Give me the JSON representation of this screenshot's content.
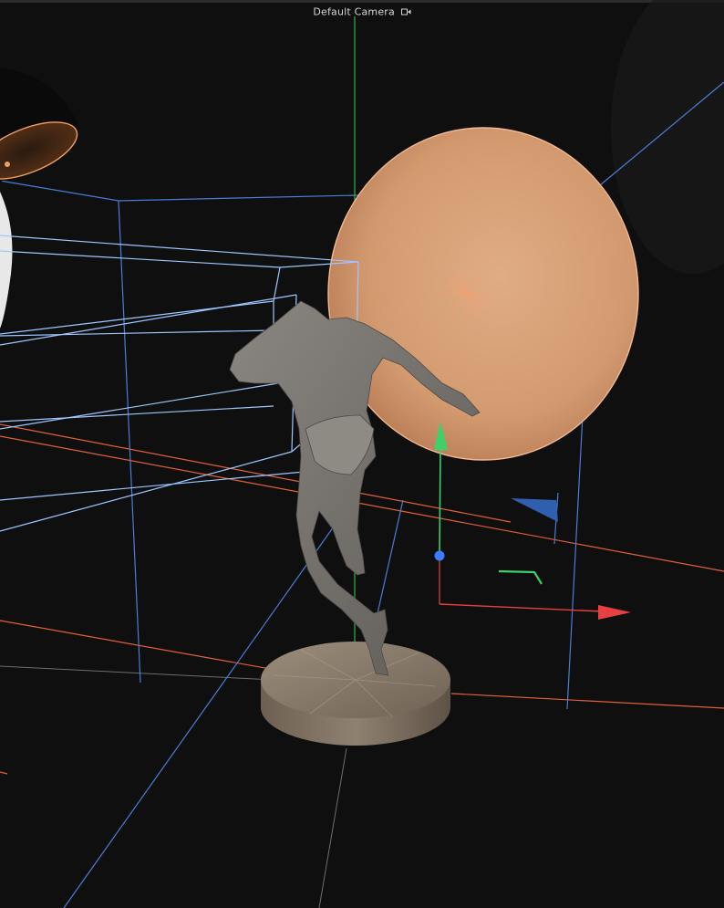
{
  "viewport": {
    "camera_label": "Default Camera",
    "camera_icon": "camera-icon"
  },
  "scene": {
    "objects": [
      {
        "name": "area-light-disc",
        "color": "#f0a060"
      },
      {
        "name": "sphere-light",
        "color": "#d9a07a"
      },
      {
        "name": "figure-sculpture",
        "color": "#7a7672"
      },
      {
        "name": "pedestal-base",
        "color": "#8c7d6c"
      }
    ],
    "gizmo": {
      "x_axis_color": "#e84040",
      "y_axis_color": "#3cd26a",
      "z_axis_color": "#3a7dff"
    },
    "guide_colors": {
      "camera_frustum": "#9fc6ff",
      "bounding_box": "#4a7dd6",
      "light_line": "#e0603a",
      "world_y": "#35b24a",
      "world_grid": "#7a7a7a"
    }
  }
}
